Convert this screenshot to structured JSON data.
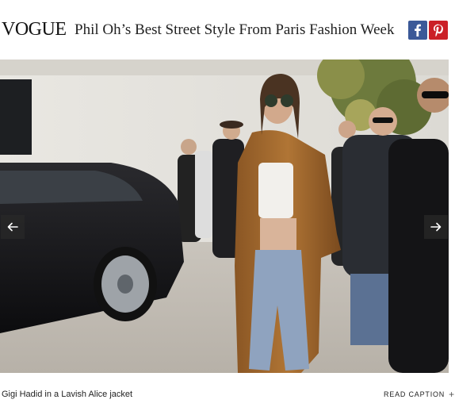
{
  "header": {
    "brand": "VOGUE",
    "headline": "Phil Oh’s Best Street Style From Paris Fashion Week",
    "share": {
      "facebook_icon": "facebook-icon",
      "pinterest_icon": "pinterest-icon",
      "facebook_color": "#3b5998",
      "pinterest_color": "#cb2027"
    }
  },
  "slideshow": {
    "photo_subject": "street-style-photo",
    "prev_icon": "arrow-left-icon",
    "next_icon": "arrow-right-icon"
  },
  "footer": {
    "caption": "Gigi Hadid in a Lavish Alice jacket",
    "read_caption": "READ CAPTION",
    "plus": "+"
  }
}
